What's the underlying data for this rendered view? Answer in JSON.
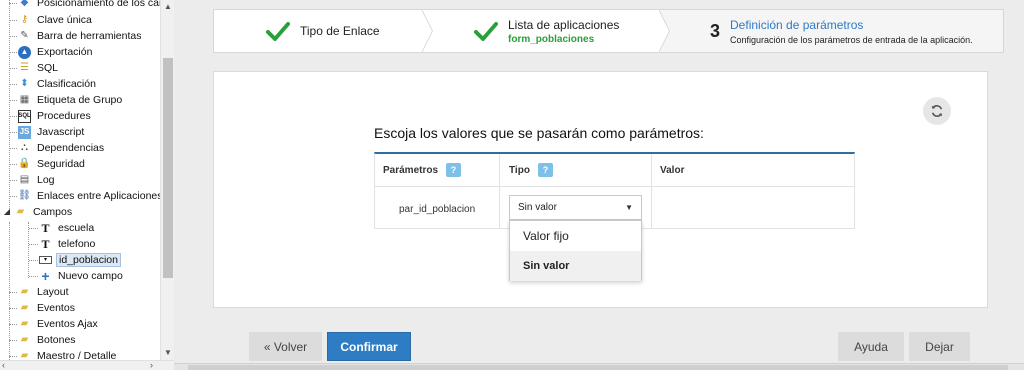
{
  "tree": {
    "items": [
      {
        "label": "Posicionamiento de los campos",
        "icon": "position-icon",
        "level": 1
      },
      {
        "label": "Clave única",
        "icon": "key-icon",
        "level": 1
      },
      {
        "label": "Barra de herramientas",
        "icon": "wrench-icon",
        "level": 1
      },
      {
        "label": "Exportación",
        "icon": "export-icon",
        "level": 1
      },
      {
        "label": "SQL",
        "icon": "database-icon",
        "level": 1
      },
      {
        "label": "Clasificación",
        "icon": "sort-icon",
        "level": 1
      },
      {
        "label": "Etiqueta de Grupo",
        "icon": "grid-icon",
        "level": 1
      },
      {
        "label": "Procedures",
        "icon": "procedures-icon",
        "level": 1
      },
      {
        "label": "Javascript",
        "icon": "javascript-icon",
        "level": 1
      },
      {
        "label": "Dependencias",
        "icon": "hierarchy-icon",
        "level": 1
      },
      {
        "label": "Seguridad",
        "icon": "lock-icon",
        "level": 1
      },
      {
        "label": "Log",
        "icon": "log-icon",
        "level": 1
      },
      {
        "label": "Enlaces entre Aplicaciones",
        "icon": "link-icon",
        "level": 1
      },
      {
        "label": "Campos",
        "icon": "folder-open-icon",
        "level": 1
      },
      {
        "label": "escuela",
        "icon": "text-field-icon",
        "level": 2
      },
      {
        "label": "telefono",
        "icon": "text-field-icon",
        "level": 2
      },
      {
        "label": "id_poblacion",
        "icon": "select-field-icon",
        "level": 2
      },
      {
        "label": "Nuevo campo",
        "icon": "plus-icon",
        "level": 2
      },
      {
        "label": "Layout",
        "icon": "folder-icon",
        "level": 1
      },
      {
        "label": "Eventos",
        "icon": "folder-icon",
        "level": 1
      },
      {
        "label": "Eventos Ajax",
        "icon": "folder-icon",
        "level": 1
      },
      {
        "label": "Botones",
        "icon": "folder-icon",
        "level": 1
      },
      {
        "label": "Maestro / Detalle",
        "icon": "folder-icon",
        "level": 1
      }
    ],
    "selected": "id_poblacion"
  },
  "wizard": {
    "step1": {
      "title": "Tipo de Enlace"
    },
    "step2": {
      "title": "Lista de aplicaciones",
      "subtitle": "form_poblaciones"
    },
    "step3": {
      "number": "3",
      "title": "Definición de parámetros",
      "subtitle": "Configuración de los parámetros de entrada de la aplicación."
    }
  },
  "form": {
    "title": "Escoja los valores que se pasarán como parámetros:",
    "headers": {
      "params": "Parámetros",
      "type": "Tipo",
      "value": "Valor",
      "help": "?"
    },
    "row": {
      "param": "par_id_poblacion",
      "type_selected": "Sin valor",
      "value": ""
    },
    "options": [
      "Valor fijo",
      "Sin valor"
    ]
  },
  "buttons": {
    "back": "« Volver",
    "confirm": "Confirmar",
    "help": "Ayuda",
    "exit": "Dejar"
  },
  "colors": {
    "check": "#2aa03a",
    "accent": "#2e7dc4",
    "step_title": "#2d7ac7"
  }
}
